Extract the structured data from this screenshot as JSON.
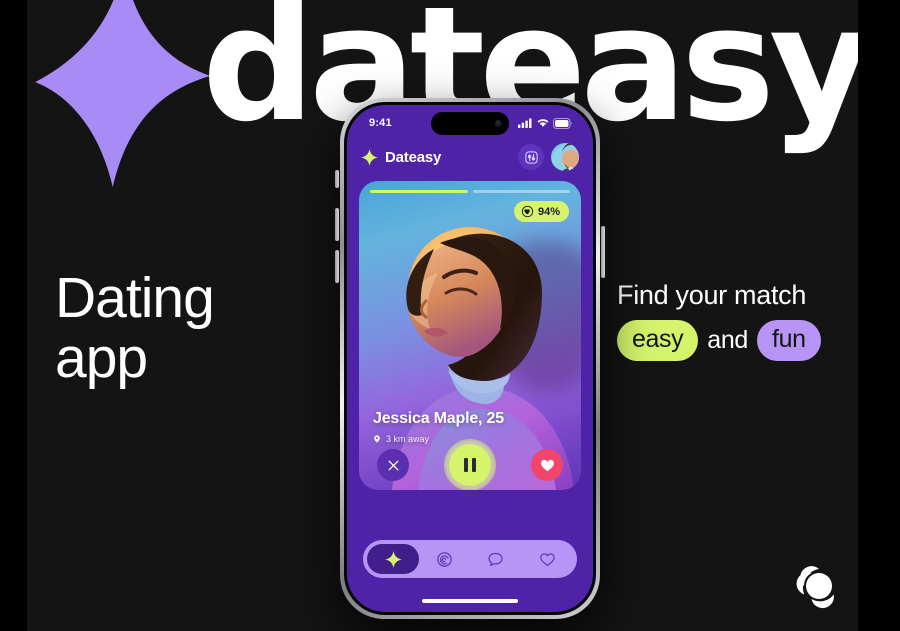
{
  "brand": {
    "wordmark": "dateasy",
    "logo_shape": "four-point-sparkle",
    "accent_lime": "#d5f36b",
    "accent_purple": "#b695f7",
    "deep_purple": "#4e23a8",
    "background": "#141414"
  },
  "headline_left": {
    "line1": "Dating",
    "line2": "app"
  },
  "headline_right": {
    "line1": "Find your match",
    "pill_easy": "easy",
    "conjunction": "and",
    "pill_fun": "fun"
  },
  "phone": {
    "status_bar": {
      "time": "9:41",
      "signal": "cellular-bars",
      "wifi": "wifi-icon",
      "battery": "battery-icon"
    },
    "app_header": {
      "sparkle": "sparkle-icon",
      "title": "Dateasy",
      "filter_button": "sliders-icon",
      "avatar": "user-avatar"
    },
    "card": {
      "progress": {
        "segments": 2,
        "active": 1
      },
      "match_badge": {
        "icon": "heart-in-circle-icon",
        "value": "94%"
      },
      "name": "Jessica Maple, 25",
      "distance": "3 km away",
      "distance_icon": "map-pin-icon",
      "actions": [
        {
          "name": "dismiss",
          "icon": "close-icon",
          "color": "#5b2fb0"
        },
        {
          "name": "pause",
          "icon": "pause-icon",
          "color": "#d5f36b"
        },
        {
          "name": "like",
          "icon": "heart-icon",
          "color": "#f1456c"
        }
      ]
    },
    "tabbar": [
      {
        "name": "discover",
        "icon": "sparkle-icon",
        "active": true
      },
      {
        "name": "explore",
        "icon": "spiral-icon",
        "active": false
      },
      {
        "name": "messages",
        "icon": "chat-bubble-icon",
        "active": false
      },
      {
        "name": "likes",
        "icon": "heart-outline-icon",
        "active": false
      }
    ]
  }
}
